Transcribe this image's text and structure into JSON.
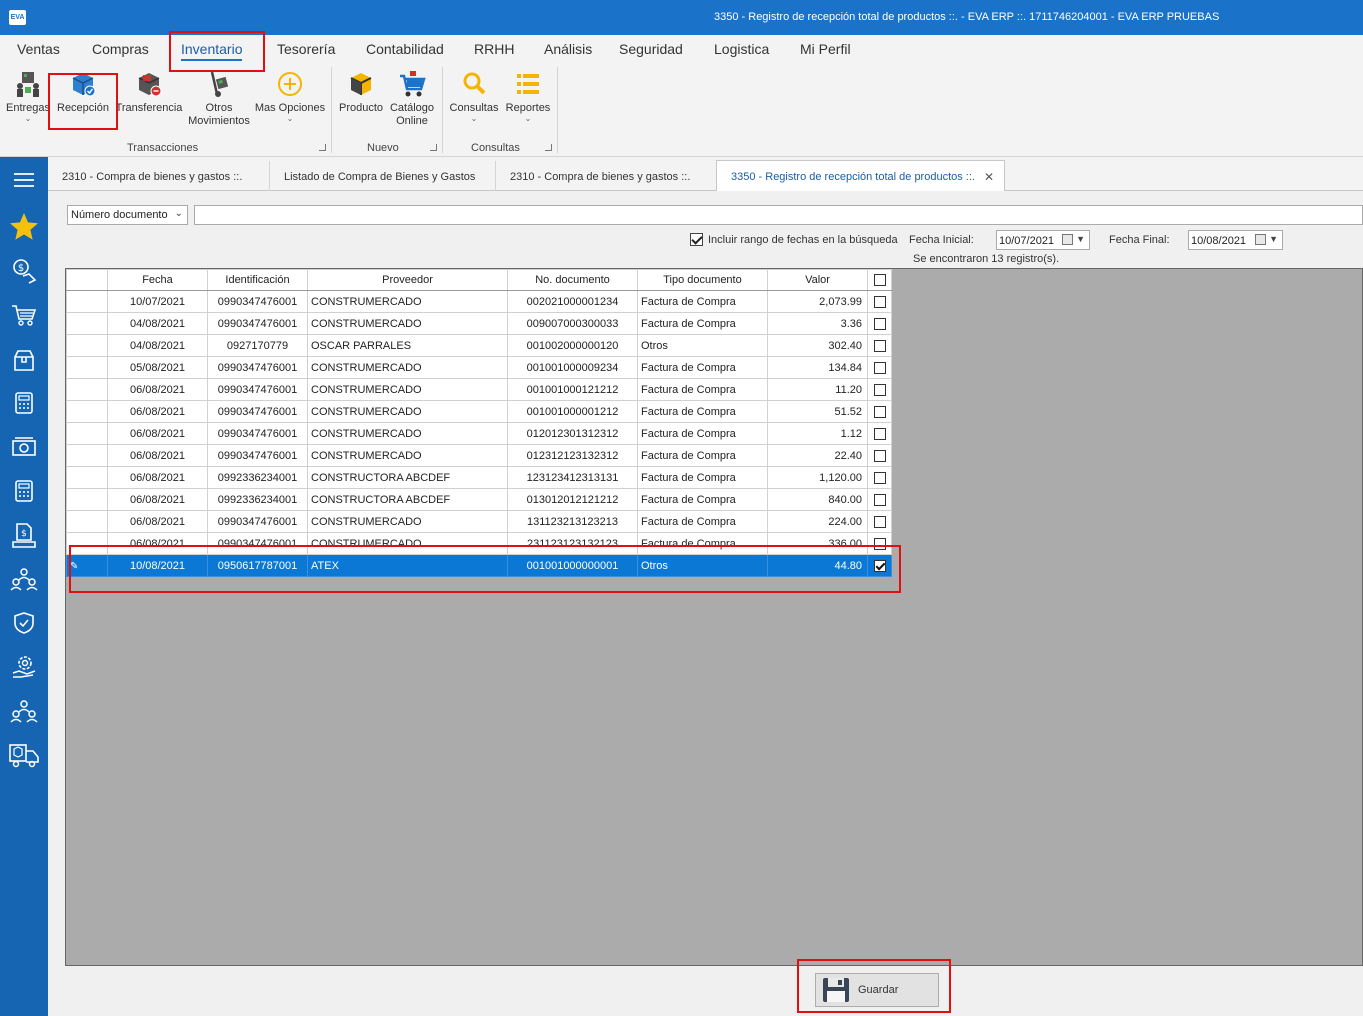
{
  "window": {
    "title": "3350 - Registro de recepción total de productos ::. - EVA ERP ::. 1711746204001 - EVA ERP PRUEBAS",
    "logo_text": "EVA"
  },
  "menu": {
    "items": [
      "Ventas",
      "Compras",
      "Inventario",
      "Tesorería",
      "Contabilidad",
      "RRHH",
      "Análisis",
      "Seguridad",
      "Logistica",
      "Mi Perfil"
    ],
    "active": "Inventario"
  },
  "ribbon": {
    "groups": [
      {
        "label": "Transacciones",
        "buttons": [
          {
            "line1": "Entregas",
            "line2": "",
            "icon": "boxes-people-icon"
          },
          {
            "line1": "Recepción",
            "line2": "",
            "icon": "box-check-icon"
          },
          {
            "line1": "Transferencia",
            "line2": "",
            "icon": "box-transfer-icon"
          },
          {
            "line1": "Otros",
            "line2": "Movimientos",
            "icon": "hand-truck-icon"
          },
          {
            "line1": "Mas Opciones",
            "line2": "",
            "icon": "plus-circle-icon"
          }
        ]
      },
      {
        "label": "Nuevo",
        "buttons": [
          {
            "line1": "Producto",
            "line2": "",
            "icon": "product-box-icon"
          },
          {
            "line1": "Catálogo",
            "line2": "Online",
            "icon": "cart-icon"
          }
        ]
      },
      {
        "label": "Consultas",
        "buttons": [
          {
            "line1": "Consultas",
            "line2": "",
            "icon": "magnifier-icon"
          },
          {
            "line1": "Reportes",
            "line2": "",
            "icon": "list-icon"
          }
        ]
      }
    ]
  },
  "sidebar": {
    "items": [
      "menu-icon",
      "star-icon",
      "money-hand-icon",
      "cart-icon",
      "box-icon",
      "calculator-icon",
      "cash-icon",
      "calculator-icon",
      "money-doc-icon",
      "people-icon",
      "shield-icon",
      "gear-hand-icon",
      "org-icon",
      "truck-icon"
    ]
  },
  "tabs": [
    {
      "label": "2310 - Compra de bienes y gastos ::.",
      "active": false
    },
    {
      "label": "Listado de Compra de Bienes y Gastos",
      "active": false
    },
    {
      "label": "2310 - Compra de bienes y gastos ::.",
      "active": false
    },
    {
      "label": "3350 - Registro de recepción total de productos ::.",
      "active": true
    }
  ],
  "search": {
    "field_selected": "Número documento",
    "value": "",
    "include_date_label": "Incluir rango de fechas en la búsqueda",
    "include_date_checked": true,
    "fecha_inicial_label": "Fecha Inicial:",
    "fecha_inicial": "10/07/2021",
    "fecha_final_label": "Fecha Final:",
    "fecha_final": "10/08/2021",
    "result_text": "Se encontraron 13 registro(s)."
  },
  "grid": {
    "columns": [
      "",
      "Fecha",
      "Identificación",
      "Proveedor",
      "No. documento",
      "Tipo documento",
      "Valor",
      ""
    ],
    "rows": [
      {
        "fecha": "10/07/2021",
        "id": "0990347476001",
        "proveedor": "CONSTRUMERCADO",
        "doc": "002021000001234",
        "tipo": "Factura de Compra",
        "valor": "2,073.99",
        "checked": false,
        "selected": false
      },
      {
        "fecha": "04/08/2021",
        "id": "0990347476001",
        "proveedor": "CONSTRUMERCADO",
        "doc": "009007000300033",
        "tipo": "Factura de Compra",
        "valor": "3.36",
        "checked": false,
        "selected": false
      },
      {
        "fecha": "04/08/2021",
        "id": "0927170779",
        "proveedor": "OSCAR PARRALES",
        "doc": "001002000000120",
        "tipo": "Otros",
        "valor": "302.40",
        "checked": false,
        "selected": false
      },
      {
        "fecha": "05/08/2021",
        "id": "0990347476001",
        "proveedor": "CONSTRUMERCADO",
        "doc": "001001000009234",
        "tipo": "Factura de Compra",
        "valor": "134.84",
        "checked": false,
        "selected": false
      },
      {
        "fecha": "06/08/2021",
        "id": "0990347476001",
        "proveedor": "CONSTRUMERCADO",
        "doc": "001001000121212",
        "tipo": "Factura de Compra",
        "valor": "11.20",
        "checked": false,
        "selected": false
      },
      {
        "fecha": "06/08/2021",
        "id": "0990347476001",
        "proveedor": "CONSTRUMERCADO",
        "doc": "001001000001212",
        "tipo": "Factura de Compra",
        "valor": "51.52",
        "checked": false,
        "selected": false
      },
      {
        "fecha": "06/08/2021",
        "id": "0990347476001",
        "proveedor": "CONSTRUMERCADO",
        "doc": "012012301312312",
        "tipo": "Factura de Compra",
        "valor": "1.12",
        "checked": false,
        "selected": false
      },
      {
        "fecha": "06/08/2021",
        "id": "0990347476001",
        "proveedor": "CONSTRUMERCADO",
        "doc": "012312123132312",
        "tipo": "Factura de Compra",
        "valor": "22.40",
        "checked": false,
        "selected": false
      },
      {
        "fecha": "06/08/2021",
        "id": "0992336234001",
        "proveedor": "CONSTRUCTORA ABCDEF",
        "doc": "123123412313131",
        "tipo": "Factura de Compra",
        "valor": "1,120.00",
        "checked": false,
        "selected": false
      },
      {
        "fecha": "06/08/2021",
        "id": "0992336234001",
        "proveedor": "CONSTRUCTORA ABCDEF",
        "doc": "013012012121212",
        "tipo": "Factura de Compra",
        "valor": "840.00",
        "checked": false,
        "selected": false
      },
      {
        "fecha": "06/08/2021",
        "id": "0990347476001",
        "proveedor": "CONSTRUMERCADO",
        "doc": "131123213123213",
        "tipo": "Factura de Compra",
        "valor": "224.00",
        "checked": false,
        "selected": false
      },
      {
        "fecha": "06/08/2021",
        "id": "0990347476001",
        "proveedor": "CONSTRUMERCADO",
        "doc": "231123123132123",
        "tipo": "Factura de Compra",
        "valor": "336.00",
        "checked": false,
        "selected": false
      },
      {
        "fecha": "10/08/2021",
        "id": "0950617787001",
        "proveedor": "ATEX",
        "doc": "001001000000001",
        "tipo": "Otros",
        "valor": "44.80",
        "checked": true,
        "selected": true
      }
    ]
  },
  "actions": {
    "save_label": "Guardar"
  },
  "colors": {
    "accent": "#1a73c8",
    "sidebar": "#1565b3",
    "selection": "#0a78d4",
    "highlight": "#e01010"
  }
}
